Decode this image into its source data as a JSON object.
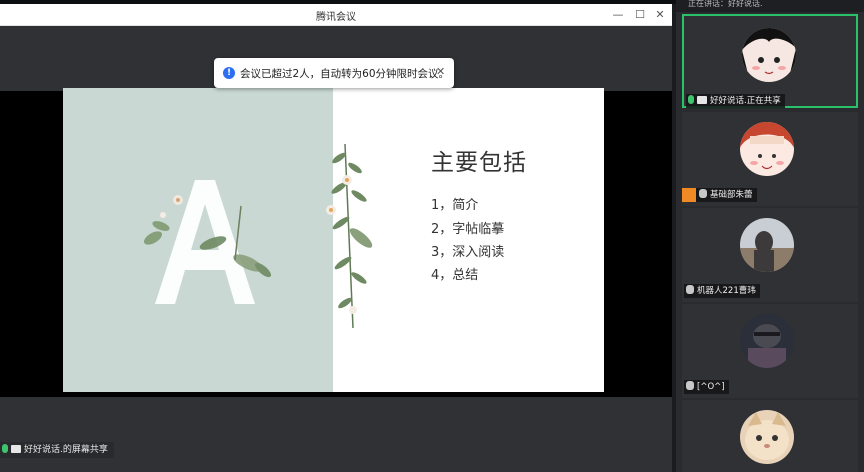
{
  "window": {
    "title": "腾讯会议",
    "minimize_glyph": "—",
    "maximize_glyph": "☐",
    "close_glyph": "✕"
  },
  "notification": {
    "icon": "info-icon",
    "icon_glyph": "!",
    "text": "会议已超过2人，自动转为60分钟限时会议。",
    "close_glyph": "✕"
  },
  "slide": {
    "title": "主要包括",
    "items": [
      "1，简介",
      "2，字帖临摹",
      "3，深入阅读",
      "4，总结"
    ],
    "colors": {
      "left_bg": "#c9d8d3",
      "right_bg": "#ffffff",
      "letter": "#ffffff"
    }
  },
  "share_label": "好好说话.的屏幕共享",
  "panel": {
    "speaking_text": "正在讲话：好好说话.",
    "participants": [
      {
        "name": "好好说话.正在共享",
        "active": true,
        "host": false
      },
      {
        "name": "基础部朱蕾",
        "active": false,
        "host": true
      },
      {
        "name": "机器人221曹玮",
        "active": false,
        "host": false
      },
      {
        "name": "[^O^]",
        "active": false,
        "host": false
      },
      {
        "name": "",
        "active": false,
        "host": false
      }
    ],
    "accent_color": "#2bc06a"
  }
}
